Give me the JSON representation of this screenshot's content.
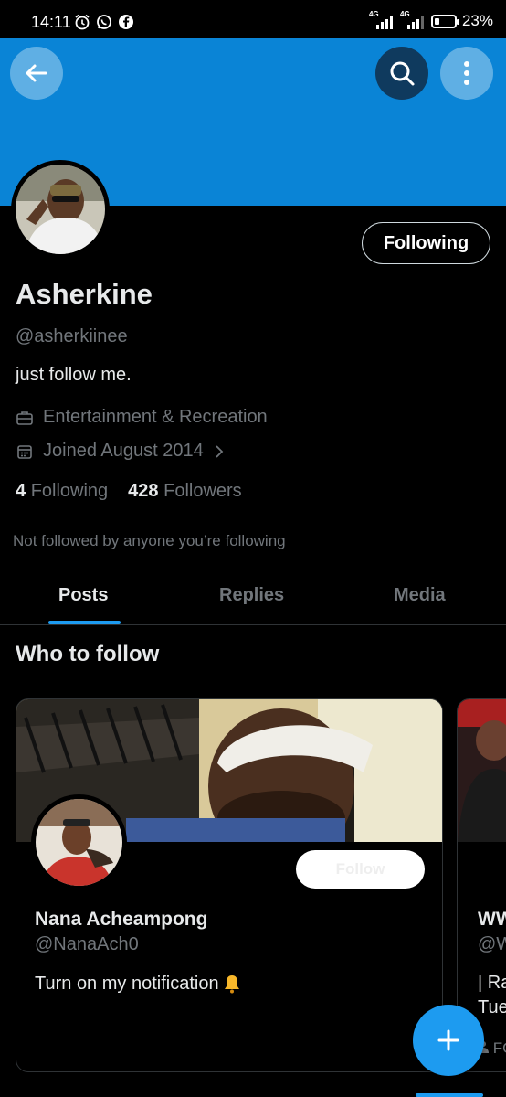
{
  "status_bar": {
    "time": "14:11",
    "net1": "4G",
    "net2": "4G",
    "battery": "23%",
    "battery_level": 0.23
  },
  "header": {
    "banner_color": "#0a84d6"
  },
  "profile": {
    "follow_button": "Following",
    "name": "Asherkine",
    "handle": "@asherkiinee",
    "bio": "just follow me.",
    "category": "Entertainment & Recreation",
    "joined": "Joined August 2014",
    "following_count": "4",
    "following_label": "Following",
    "followers_count": "428",
    "followers_label": "Followers",
    "not_followed_text": "Not followed by anyone you’re following"
  },
  "tabs": [
    {
      "label": "Posts",
      "active": true
    },
    {
      "label": "Replies",
      "active": false
    },
    {
      "label": "Media",
      "active": false
    }
  ],
  "who_to_follow": {
    "title": "Who to follow",
    "cards": [
      {
        "name": "Nana Acheampong",
        "handle": "@NanaAch0",
        "bio": "Turn on my notification",
        "bio_emoji": "bell-icon",
        "follow_label": "Follow"
      },
      {
        "name": "WW",
        "handle": "@W",
        "bio_line1": "| Ra",
        "bio_line2": "Tue",
        "meta": "FO"
      }
    ]
  },
  "accent_color": "#1d9bf0"
}
